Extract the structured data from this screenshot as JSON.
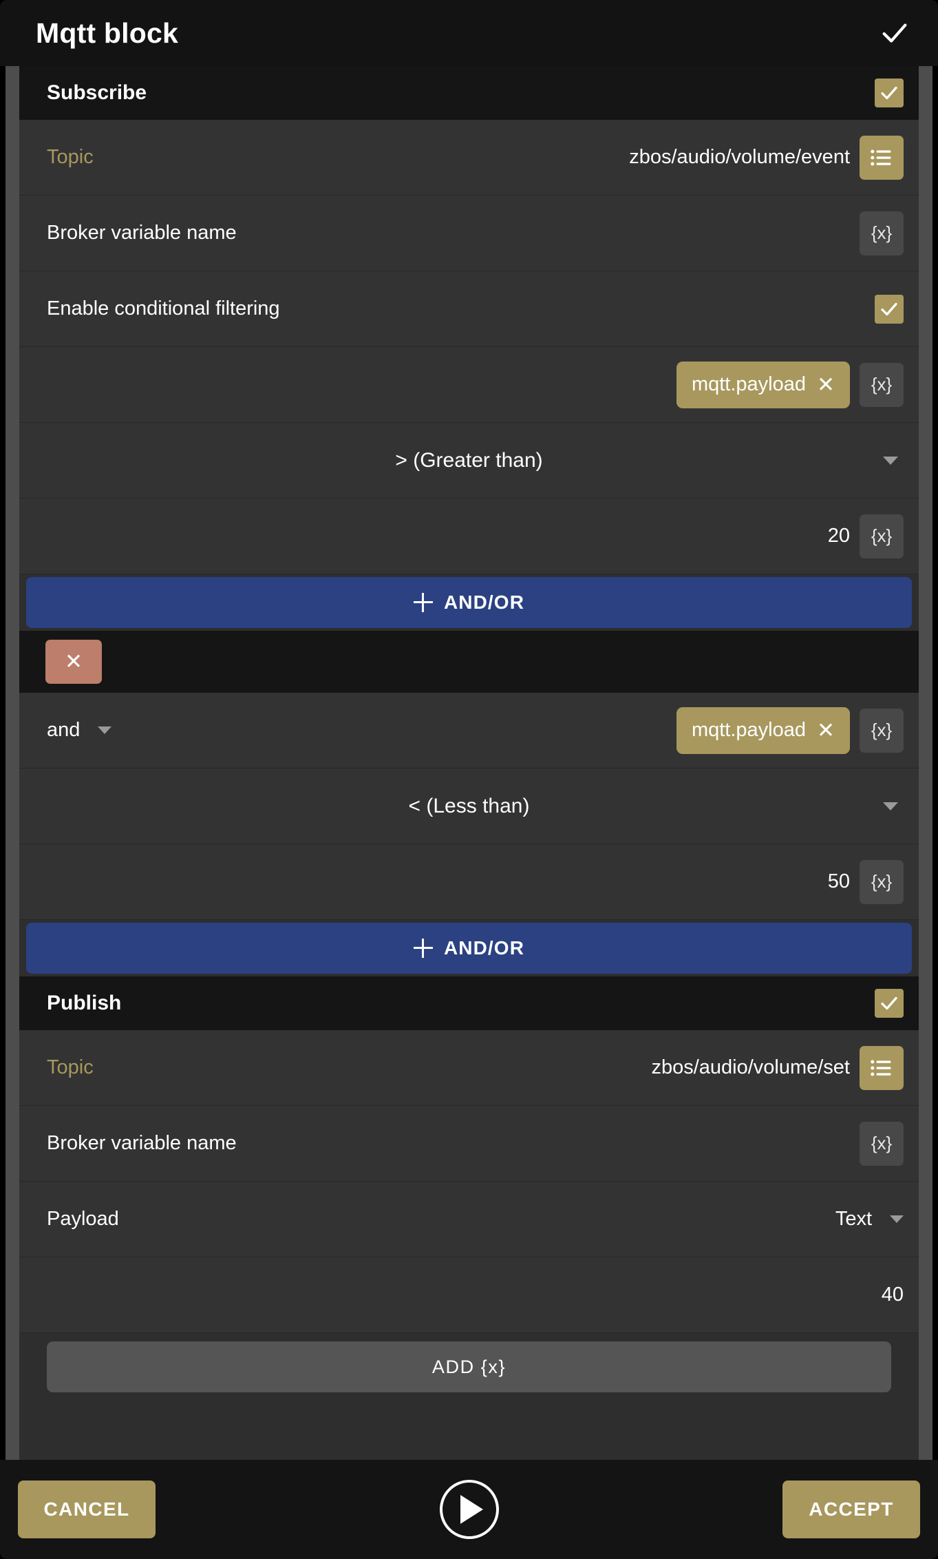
{
  "window": {
    "title": "Mqtt block",
    "confirm_icon": "check-icon"
  },
  "subscribe": {
    "header_label": "Subscribe",
    "enabled": true,
    "topic": {
      "label": "Topic",
      "value": "zbos/audio/volume/event",
      "picker_icon": "list-icon"
    },
    "broker_variable": {
      "label": "Broker variable name",
      "value": "",
      "var_button": "{x}"
    },
    "conditional_filtering": {
      "label": "Enable conditional filtering",
      "enabled": true
    },
    "conditions": [
      {
        "logic_operator": null,
        "chip_label": "mqtt.payload",
        "chip_remove_icon": "close-icon",
        "var_button": "{x}",
        "comparator": "> (Greater than)",
        "compare_value": "20",
        "value_var_button": "{x}",
        "delete_icon": null
      },
      {
        "logic_operator": "and",
        "chip_label": "mqtt.payload",
        "chip_remove_icon": "close-icon",
        "var_button": "{x}",
        "comparator": "< (Less than)",
        "compare_value": "50",
        "value_var_button": "{x}",
        "delete_icon": "close-icon"
      }
    ],
    "add_condition_label": "AND/OR"
  },
  "publish": {
    "header_label": "Publish",
    "enabled": true,
    "topic": {
      "label": "Topic",
      "value": "zbos/audio/volume/set",
      "picker_icon": "list-icon"
    },
    "broker_variable": {
      "label": "Broker variable name",
      "value": "",
      "var_button": "{x}"
    },
    "payload": {
      "label": "Payload",
      "type_value": "Text",
      "value": "40"
    },
    "add_variable_label": "ADD  {x}"
  },
  "footer": {
    "cancel_label": "CANCEL",
    "accept_label": "ACCEPT",
    "play_icon": "play-icon"
  },
  "colors": {
    "gold": "#a8985e",
    "blue": "#2b4182",
    "salmon": "#bd7e6c",
    "row_bg": "#333333",
    "header_bg": "#151515",
    "page_bg": "#000000"
  }
}
